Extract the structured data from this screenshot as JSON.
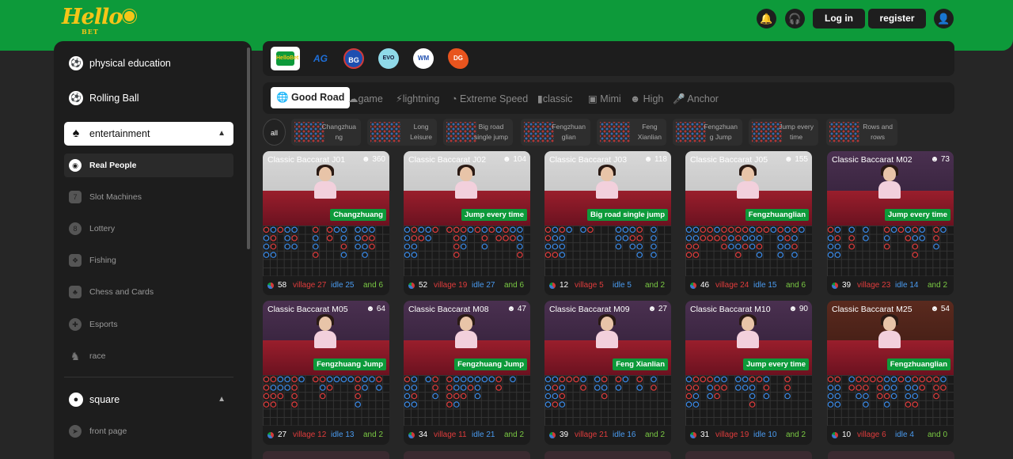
{
  "header": {
    "logo_text": "Hello",
    "logo_sub": "BET",
    "login_label": "Log in",
    "register_label": "register"
  },
  "sidebar": {
    "main_items": [
      {
        "label": "physical education",
        "icon": "soccer-ball-icon"
      },
      {
        "label": "Rolling Ball",
        "icon": "rolling-ball-icon"
      },
      {
        "label": "entertainment",
        "icon": "spade-icon",
        "expanded": true
      }
    ],
    "sub_items": [
      {
        "label": "Real People",
        "icon": "target-icon",
        "active": true
      },
      {
        "label": "Slot Machines",
        "icon": "slot-777-icon"
      },
      {
        "label": "Lottery",
        "icon": "lottery-8-ball-icon"
      },
      {
        "label": "Fishing",
        "icon": "fish-icon"
      },
      {
        "label": "Chess and Cards",
        "icon": "cards-icon"
      },
      {
        "label": "Esports",
        "icon": "gamepad-icon"
      },
      {
        "label": "race",
        "icon": "horse-icon"
      }
    ],
    "square": {
      "label": "square",
      "icon": "user-circle-icon",
      "expanded": true
    },
    "square_items": [
      {
        "label": "front page",
        "icon": "compass-icon"
      }
    ]
  },
  "providers": [
    "HelloBet",
    "AG",
    "BG",
    "EVO",
    "WM",
    "DG"
  ],
  "categories": [
    {
      "label": "Good Road",
      "icon": "globe-icon",
      "active": true
    },
    {
      "label": "game",
      "icon": "cloud-icon"
    },
    {
      "label": "lightning",
      "icon": "lightning-icon"
    },
    {
      "label": "Extreme Speed",
      "icon": "speedometer-icon"
    },
    {
      "label": "classic",
      "icon": "car-icon"
    },
    {
      "label": "Mimi",
      "icon": "camera-icon"
    },
    {
      "label": "High",
      "icon": "dealer-icon"
    },
    {
      "label": "Anchor",
      "icon": "microphone-icon"
    }
  ],
  "road_filters": {
    "all_label": "all",
    "items": [
      {
        "line1": "Changzhua",
        "line2": "ng"
      },
      {
        "line1": "Long",
        "line2": "Leisure"
      },
      {
        "line1": "Big road",
        "line2": "single jump"
      },
      {
        "line1": "Fengzhuan",
        "line2": "glian"
      },
      {
        "line1": "Feng",
        "line2": "Xianlian"
      },
      {
        "line1": "Fengzhuan",
        "line2": "g Jump"
      },
      {
        "line1": "Jump every",
        "line2": "time"
      },
      {
        "line1": "Rows and",
        "line2": "rows"
      }
    ]
  },
  "tables": [
    {
      "title": "Classic Baccarat J01",
      "online": "360",
      "badge": "Changzhuang",
      "total": "58",
      "village": "27",
      "idle": "25",
      "and": "6",
      "theme": "bright"
    },
    {
      "title": "Classic Baccarat J02",
      "online": "104",
      "badge": "Jump every time",
      "total": "52",
      "village": "19",
      "idle": "27",
      "and": "6",
      "theme": "bright"
    },
    {
      "title": "Classic Baccarat J03",
      "online": "118",
      "badge": "Big road single jump",
      "total": "12",
      "village": "5",
      "idle": "5",
      "and": "2",
      "theme": "bright"
    },
    {
      "title": "Classic Baccarat J05",
      "online": "155",
      "badge": "Fengzhuanglian",
      "total": "46",
      "village": "24",
      "idle": "15",
      "and": "6",
      "theme": "bright"
    },
    {
      "title": "Classic Baccarat M02",
      "online": "73",
      "badge": "Jump every time",
      "total": "39",
      "village": "23",
      "idle": "14",
      "and": "2",
      "theme": "purple"
    },
    {
      "title": "Classic Baccarat M05",
      "online": "64",
      "badge": "Fengzhuang Jump",
      "total": "27",
      "village": "12",
      "idle": "13",
      "and": "2",
      "theme": "purple"
    },
    {
      "title": "Classic Baccarat M08",
      "online": "47",
      "badge": "Fengzhuang Jump",
      "total": "34",
      "village": "11",
      "idle": "21",
      "and": "2",
      "theme": "purple"
    },
    {
      "title": "Classic Baccarat M09",
      "online": "27",
      "badge": "Feng Xianlian",
      "total": "39",
      "village": "21",
      "idle": "16",
      "and": "2",
      "theme": "purple"
    },
    {
      "title": "Classic Baccarat M10",
      "online": "90",
      "badge": "Jump every time",
      "total": "31",
      "village": "19",
      "idle": "10",
      "and": "2",
      "theme": "purple"
    },
    {
      "title": "Classic Baccarat M25",
      "online": "54",
      "badge": "Fengzhuanglian",
      "total": "10",
      "village": "6",
      "idle": "4",
      "and": "0",
      "theme": "red"
    }
  ],
  "colors": {
    "brand_green": "#0d9a3a",
    "brand_yellow": "#f5c518",
    "banker_red": "#e03c3c",
    "player_blue": "#4a9bf0",
    "tie_green": "#7ac943"
  }
}
